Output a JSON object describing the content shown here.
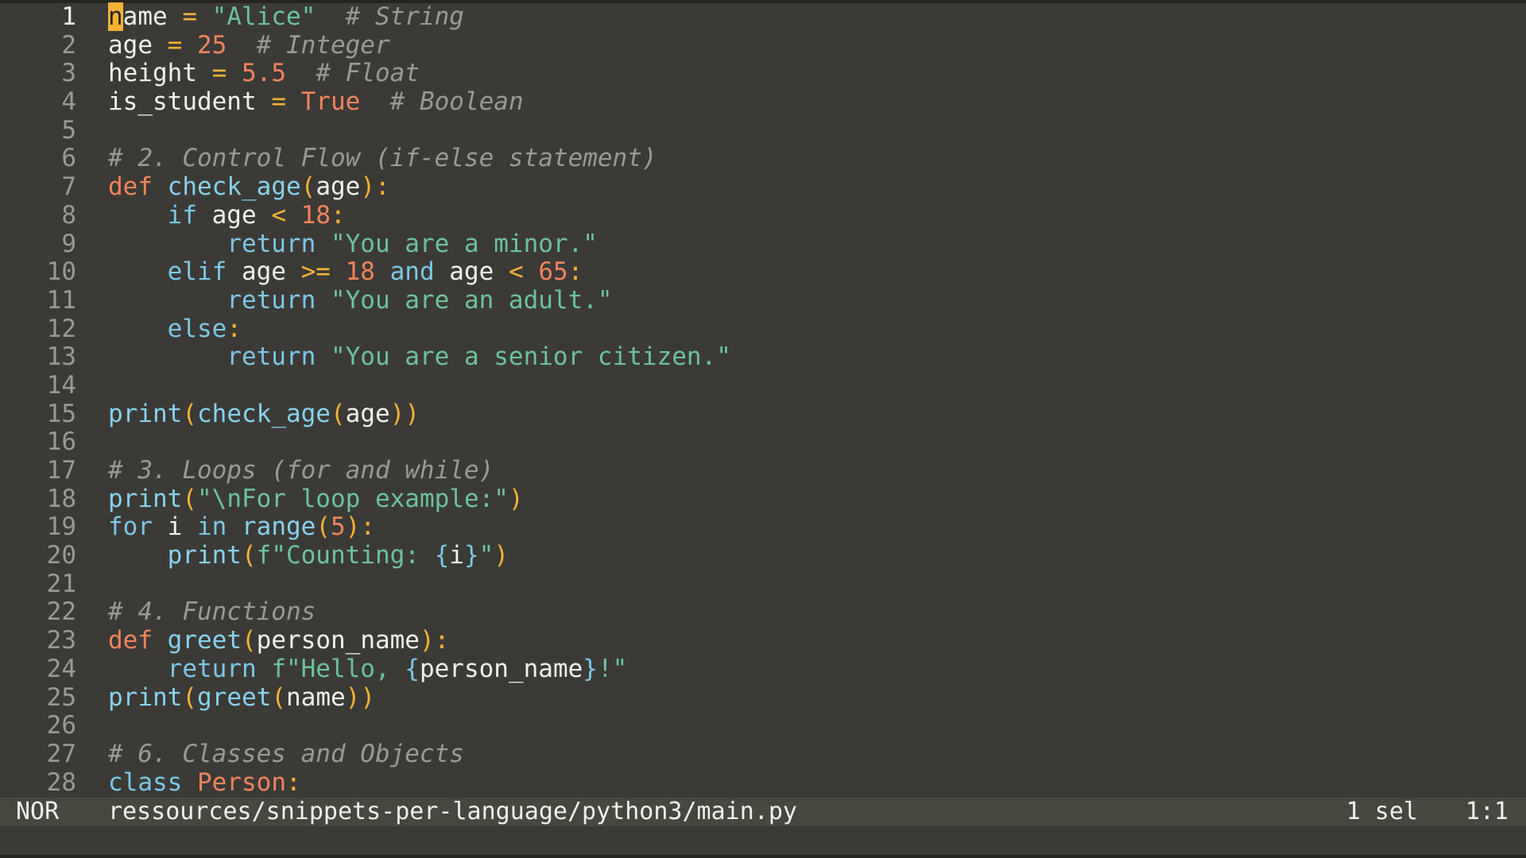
{
  "editor": {
    "lines": [
      [
        [
          "cursor",
          "n"
        ],
        [
          "plain",
          "ame "
        ],
        [
          "op",
          "="
        ],
        [
          "plain",
          " "
        ],
        [
          "str",
          "\"Alice\""
        ],
        [
          "plain",
          "  "
        ],
        [
          "comment",
          "# String"
        ]
      ],
      [
        [
          "plain",
          "age "
        ],
        [
          "op",
          "="
        ],
        [
          "plain",
          " "
        ],
        [
          "num",
          "25"
        ],
        [
          "plain",
          "  "
        ],
        [
          "comment",
          "# Integer"
        ]
      ],
      [
        [
          "plain",
          "height "
        ],
        [
          "op",
          "="
        ],
        [
          "plain",
          " "
        ],
        [
          "num",
          "5.5"
        ],
        [
          "plain",
          "  "
        ],
        [
          "comment",
          "# Float"
        ]
      ],
      [
        [
          "plain",
          "is_student "
        ],
        [
          "op",
          "="
        ],
        [
          "plain",
          " "
        ],
        [
          "bool",
          "True"
        ],
        [
          "plain",
          "  "
        ],
        [
          "comment",
          "# Boolean"
        ]
      ],
      [],
      [
        [
          "comment",
          "# 2. Control Flow (if-else statement)"
        ]
      ],
      [
        [
          "kw-def",
          "def"
        ],
        [
          "plain",
          " "
        ],
        [
          "fn",
          "check_age"
        ],
        [
          "paren",
          "("
        ],
        [
          "plain",
          "age"
        ],
        [
          "paren",
          ")"
        ],
        [
          "op",
          ":"
        ]
      ],
      [
        [
          "plain",
          "    "
        ],
        [
          "kw",
          "if"
        ],
        [
          "plain",
          " age "
        ],
        [
          "op",
          "<"
        ],
        [
          "plain",
          " "
        ],
        [
          "num",
          "18"
        ],
        [
          "op",
          ":"
        ]
      ],
      [
        [
          "plain",
          "        "
        ],
        [
          "kw",
          "return"
        ],
        [
          "plain",
          " "
        ],
        [
          "str",
          "\"You are a minor.\""
        ]
      ],
      [
        [
          "plain",
          "    "
        ],
        [
          "kw",
          "elif"
        ],
        [
          "plain",
          " age "
        ],
        [
          "op",
          ">="
        ],
        [
          "plain",
          " "
        ],
        [
          "num",
          "18"
        ],
        [
          "plain",
          " "
        ],
        [
          "kw",
          "and"
        ],
        [
          "plain",
          " age "
        ],
        [
          "op",
          "<"
        ],
        [
          "plain",
          " "
        ],
        [
          "num",
          "65"
        ],
        [
          "op",
          ":"
        ]
      ],
      [
        [
          "plain",
          "        "
        ],
        [
          "kw",
          "return"
        ],
        [
          "plain",
          " "
        ],
        [
          "str",
          "\"You are an adult.\""
        ]
      ],
      [
        [
          "plain",
          "    "
        ],
        [
          "kw",
          "else"
        ],
        [
          "op",
          ":"
        ]
      ],
      [
        [
          "plain",
          "        "
        ],
        [
          "kw",
          "return"
        ],
        [
          "plain",
          " "
        ],
        [
          "str",
          "\"You are a senior citizen.\""
        ]
      ],
      [],
      [
        [
          "fn",
          "print"
        ],
        [
          "paren",
          "("
        ],
        [
          "fn",
          "check_age"
        ],
        [
          "paren",
          "("
        ],
        [
          "plain",
          "age"
        ],
        [
          "paren",
          "))"
        ]
      ],
      [],
      [
        [
          "comment",
          "# 3. Loops (for and while)"
        ]
      ],
      [
        [
          "fn",
          "print"
        ],
        [
          "paren",
          "("
        ],
        [
          "str",
          "\"\\nFor loop example:\""
        ],
        [
          "paren",
          ")"
        ]
      ],
      [
        [
          "kw",
          "for"
        ],
        [
          "plain",
          " i "
        ],
        [
          "kw",
          "in"
        ],
        [
          "plain",
          " "
        ],
        [
          "fn",
          "range"
        ],
        [
          "paren",
          "("
        ],
        [
          "num",
          "5"
        ],
        [
          "paren",
          ")"
        ],
        [
          "op",
          ":"
        ]
      ],
      [
        [
          "plain",
          "    "
        ],
        [
          "fn",
          "print"
        ],
        [
          "paren",
          "("
        ],
        [
          "str",
          "f\"Counting: "
        ],
        [
          "brace",
          "{"
        ],
        [
          "plain",
          "i"
        ],
        [
          "brace",
          "}"
        ],
        [
          "str",
          "\""
        ],
        [
          "paren",
          ")"
        ]
      ],
      [],
      [
        [
          "comment",
          "# 4. Functions"
        ]
      ],
      [
        [
          "kw-def",
          "def"
        ],
        [
          "plain",
          " "
        ],
        [
          "fn",
          "greet"
        ],
        [
          "paren",
          "("
        ],
        [
          "plain",
          "person_name"
        ],
        [
          "paren",
          ")"
        ],
        [
          "op",
          ":"
        ]
      ],
      [
        [
          "plain",
          "    "
        ],
        [
          "kw",
          "return"
        ],
        [
          "plain",
          " "
        ],
        [
          "str",
          "f\"Hello, "
        ],
        [
          "brace",
          "{"
        ],
        [
          "plain",
          "person_name"
        ],
        [
          "brace",
          "}"
        ],
        [
          "str",
          "!\""
        ]
      ],
      [
        [
          "fn",
          "print"
        ],
        [
          "paren",
          "("
        ],
        [
          "fn",
          "greet"
        ],
        [
          "paren",
          "("
        ],
        [
          "plain",
          "name"
        ],
        [
          "paren",
          "))"
        ]
      ],
      [],
      [
        [
          "comment",
          "# 6. Classes and Objects"
        ]
      ],
      [
        [
          "kw",
          "class"
        ],
        [
          "plain",
          " "
        ],
        [
          "class",
          "Person"
        ],
        [
          "op",
          ":"
        ]
      ]
    ],
    "first_line_number": 1,
    "current_line": 1
  },
  "statusbar": {
    "mode": "NOR",
    "filepath": "ressources/snippets-per-language/python3/main.py",
    "selection": "1 sel",
    "position": "1:1"
  },
  "colors": {
    "background": "#3b3a36",
    "statusbar": "#47463f",
    "cursor": "#f5b335",
    "string": "#6cc39a",
    "number": "#f2845c",
    "keyword": "#7cc7e6",
    "comment": "#9a9a94"
  }
}
